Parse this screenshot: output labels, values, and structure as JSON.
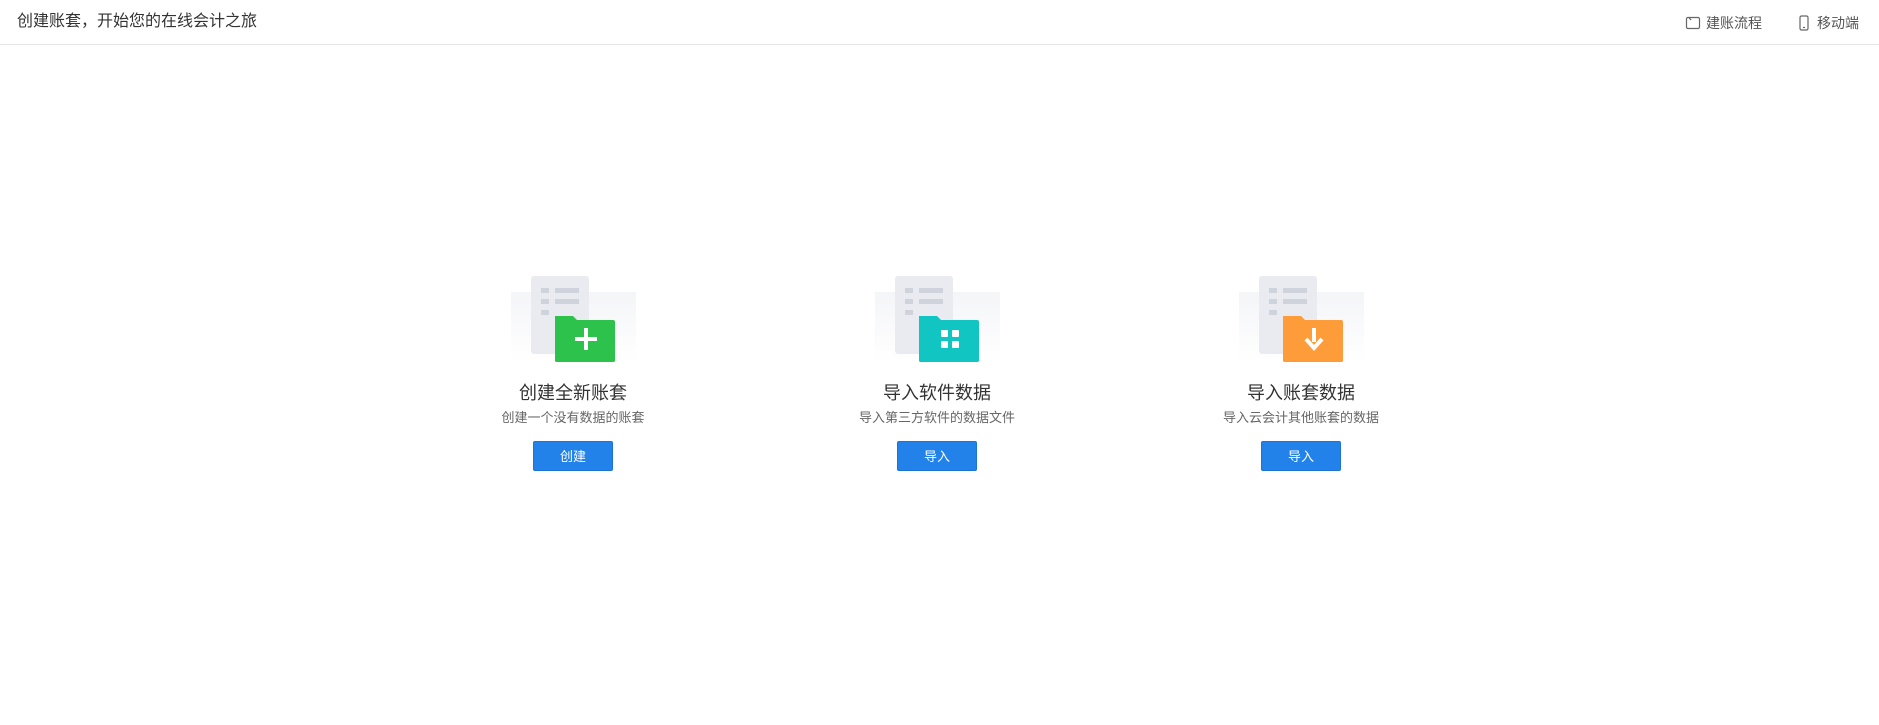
{
  "header": {
    "title": "创建账套，开始您的在线会计之旅",
    "links": [
      {
        "label": "建账流程",
        "icon": "flow-icon"
      },
      {
        "label": "移动端",
        "icon": "mobile-icon"
      }
    ]
  },
  "cards": [
    {
      "title": "创建全新账套",
      "description": "创建一个没有数据的账套",
      "button": "创建",
      "icon": "plus-icon",
      "color": "#2dc24b"
    },
    {
      "title": "导入软件数据",
      "description": "导入第三方软件的数据文件",
      "button": "导入",
      "icon": "grid-icon",
      "color": "#11c6c2"
    },
    {
      "title": "导入账套数据",
      "description": "导入云会计其他账套的数据",
      "button": "导入",
      "icon": "download-icon",
      "color": "#ff9c3a"
    }
  ]
}
